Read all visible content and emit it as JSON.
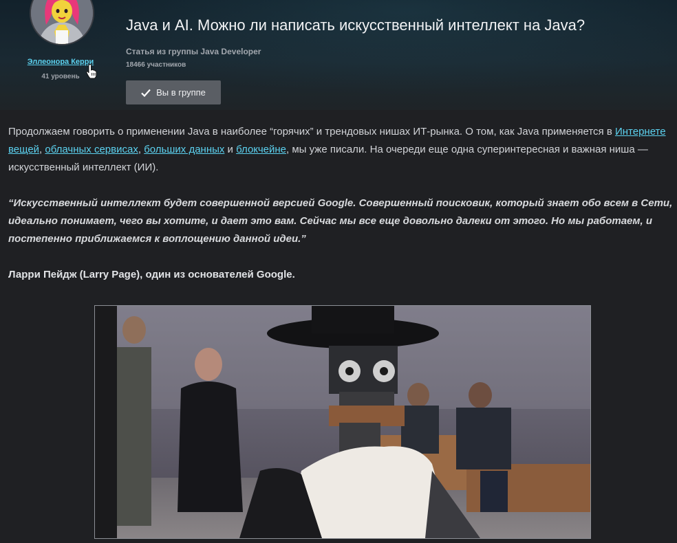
{
  "author": {
    "name": "Эллеонора Керри",
    "level": "41 уровень"
  },
  "article": {
    "title": "Java и AI. Можно ли написать искусственный интеллект на Java?",
    "group_line": "Статья из группы Java Developer",
    "members": "18466 участников",
    "group_button": "Вы в группе"
  },
  "body": {
    "p1_text1": "Продолжаем говорить о применении Java в наиболее “горячих” и трендовых нишах ИТ-рынка. О том, как Java применяется в ",
    "link_iot": "Интернете вещей",
    "sep1": ", ",
    "link_cloud": "облачных сервисах",
    "sep2": ", ",
    "link_bigdata": "больших данных",
    "sep3": " и ",
    "link_blockchain": "блокчейне",
    "p1_text2": ", мы уже писали. На очереди еще одна суперинтересная и важная ниша — искусственный интеллект (ИИ).",
    "quote": "“Искусственный интеллект будет совершенной версией Google. Совершенный поисковик, который знает обо всем в Сети, идеально понимает, чего вы хотите, и дает это вам. Сейчас мы все еще довольно далеки от этого. Но мы работаем, и постепенно приближаемся к воплощению данной идеи.”",
    "quote_author": "Ларри Пейдж (Larry Page), один из основателей Google."
  },
  "icons": {
    "check": "check-icon",
    "cursor": "hand-pointer-icon"
  },
  "colors": {
    "link": "#5cd2f0",
    "background": "#1f2023",
    "button": "#5a5e64"
  }
}
